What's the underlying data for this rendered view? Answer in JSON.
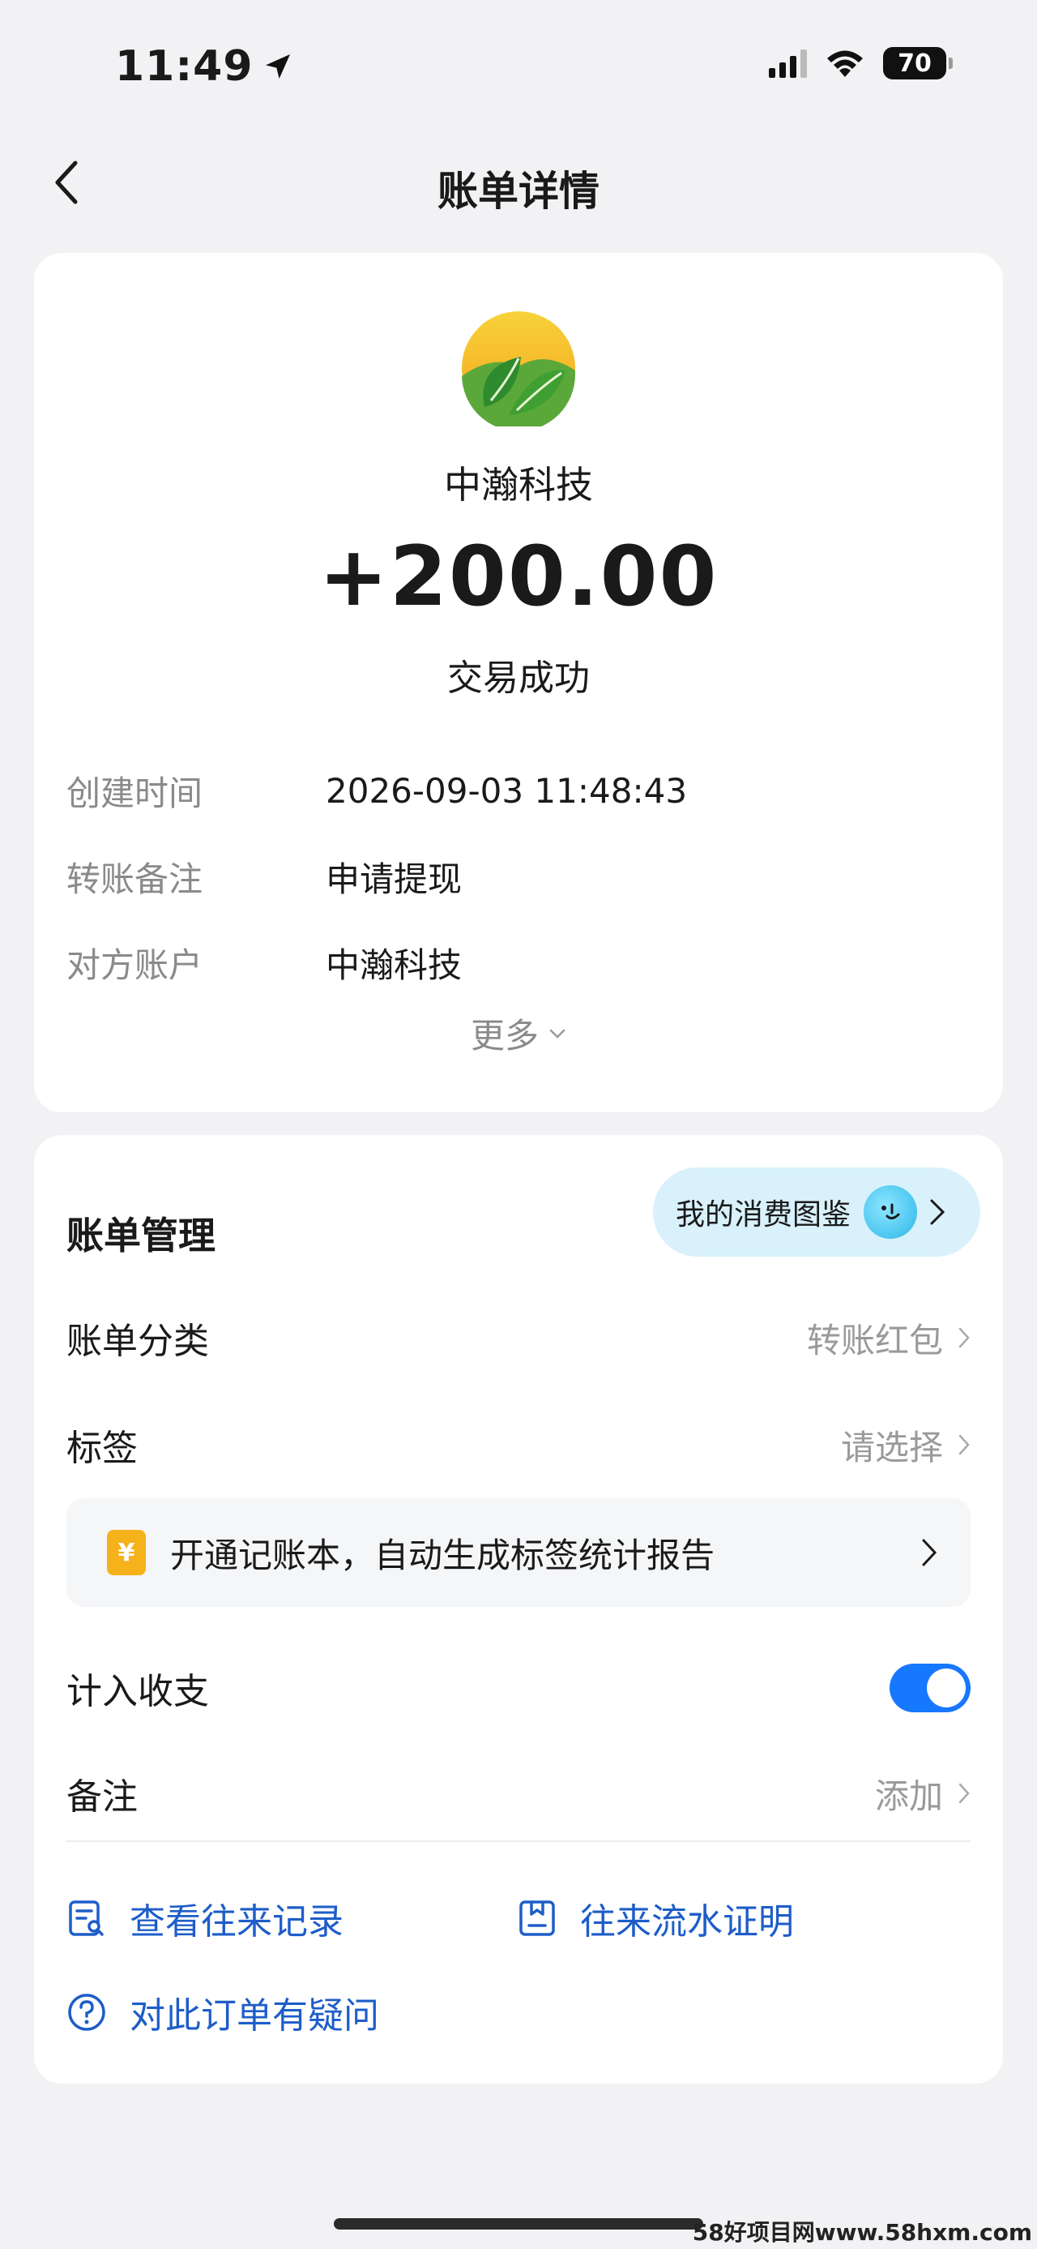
{
  "status_bar": {
    "time": "11:49",
    "battery": "70"
  },
  "nav": {
    "title": "账单详情"
  },
  "summary": {
    "merchant": "中瀚科技",
    "amount": "+200.00",
    "status": "交易成功",
    "details": [
      {
        "label": "创建时间",
        "value": "2026-09-03 11:48:43"
      },
      {
        "label": "转账备注",
        "value": "申请提现"
      },
      {
        "label": "对方账户",
        "value": "中瀚科技"
      }
    ],
    "more": "更多"
  },
  "management": {
    "title": "账单管理",
    "atlas": "我的消费图鉴",
    "category_label": "账单分类",
    "category_value": "转账红包",
    "tag_label": "标签",
    "tag_value": "请选择",
    "promo_icon": "¥",
    "promo_text": "开通记账本，自动生成标签统计报告",
    "include_label": "计入收支",
    "include_enabled": true,
    "note_label": "备注",
    "note_value": "添加"
  },
  "actions": {
    "records": "查看往来记录",
    "proof": "往来流水证明",
    "question": "对此订单有疑问"
  },
  "watermark": "58好项目网www.58hxm.com",
  "colors": {
    "accent": "#1677ff",
    "link": "#1e5dc9",
    "promo_icon": "#f6b21b"
  }
}
